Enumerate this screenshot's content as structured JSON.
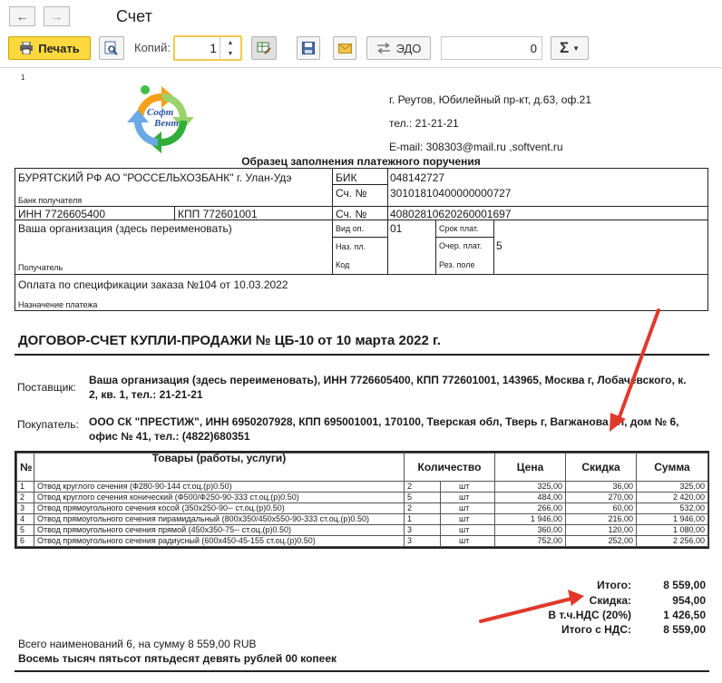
{
  "window": {
    "title": "Счет"
  },
  "toolbar": {
    "print_label": "Печать",
    "copies_label": "Копий:",
    "copies_value": "1",
    "edo_label": "ЭДО",
    "sum_value": "0",
    "sigma_label": "Σ"
  },
  "doc": {
    "page_number": "1",
    "logo_text_1": "Софт",
    "logo_text_2": "Вент",
    "address": "г. Реутов, Юбилейный пр-кт, д.63, оф.21",
    "phone": "тел.: 21-21-21",
    "email": "E-mail: 308303@mail.ru ,softvent.ru",
    "sample_title": "Образец заполнения платежного поручения",
    "payment": {
      "bank_name": "БУРЯТСКИЙ РФ АО \"РОССЕЛЬХОЗБАНК\" г. Улан-Удэ",
      "bank_caption": "Банк получателя",
      "bik_label": "БИК",
      "bik_value": "048142727",
      "corr_label": "Сч. №",
      "corr_value": "30101810400000000727",
      "inn": "ИНН   7726605400",
      "kpp": "КПП    772601001",
      "acc_label": "Сч. №",
      "acc_value": "40802810620260001697",
      "org_name": "Ваша организация (здесь переименовать)",
      "recipient_caption": "Получатель",
      "vid_op_label": "Вид оп.",
      "vid_op_value": "01",
      "srok_label": "Срок плат.",
      "naz_label": "Наз. пл.",
      "ocher_label": "Очер. плат.",
      "ocher_value": "5",
      "kod_label": "Код",
      "rez_label": "Рез. поле",
      "purpose": "Оплата по спецификации заказа №104 от 10.03.2022",
      "purpose_caption": "Назначение платежа"
    },
    "contract_title": "ДОГОВОР-СЧЕТ КУПЛИ-ПРОДАЖИ № ЦБ-10 от 10 марта 2022 г.",
    "supplier_label": "Поставщик:",
    "supplier_text": "Ваша организация (здесь переименовать), ИНН 7726605400, КПП 772601001, 143965, Москва г, Лобачевского, к. 2, кв. 1, тел.: 21-21-21",
    "buyer_label": "Покупатель:",
    "buyer_text": "ООО СК \"ПРЕСТИЖ\", ИНН 6950207928, КПП 695001001, 170100, Тверская обл, Тверь г, Вагжанова ул, дом № 6, офис № 41, тел.: (4822)680351",
    "table": {
      "headers": [
        "№",
        "Товары (работы, услуги)",
        "Количество",
        "Цена",
        "Скидка",
        "Сумма"
      ],
      "rows": [
        {
          "n": "1",
          "name": "Отвод круглого сечения (Ф280-90-144  ст.оц.(р)0.50)",
          "qty": "2",
          "unit": "шт",
          "price": "325,00",
          "discount": "36,00",
          "sum": "325,00"
        },
        {
          "n": "2",
          "name": "Отвод круглого сечения конический (Ф500/Ф250-90-333  ст.оц.(р)0.50)",
          "qty": "5",
          "unit": "шт",
          "price": "484,00",
          "discount": "270,00",
          "sum": "2 420,00"
        },
        {
          "n": "3",
          "name": "Отвод прямоугольного сечения косой (350х250-90--  ст.оц.(р)0.50)",
          "qty": "2",
          "unit": "шт",
          "price": "266,00",
          "discount": "60,00",
          "sum": "532,00"
        },
        {
          "n": "4",
          "name": "Отвод прямоугольного сечения пирамидальный (800х350/450х550-90-333 ст.оц.(р)0.50)",
          "qty": "1",
          "unit": "шт",
          "price": "1 946,00",
          "discount": "216,00",
          "sum": "1 946,00"
        },
        {
          "n": "5",
          "name": "Отвод прямоугольного сечения прямой (450х350-75--  ст.оц.(р)0.50)",
          "qty": "3",
          "unit": "шт",
          "price": "360,00",
          "discount": "120,00",
          "sum": "1 080,00"
        },
        {
          "n": "6",
          "name": "Отвод прямоугольного сечения радиусный (600х450-45-155  ст.оц.(р)0.50)",
          "qty": "3",
          "unit": "шт",
          "price": "752,00",
          "discount": "252,00",
          "sum": "2 256,00"
        }
      ]
    },
    "totals": [
      {
        "label": "Итого:",
        "value": "8 559,00"
      },
      {
        "label": "Скидка:",
        "value": "954,00"
      },
      {
        "label": "В т.ч.НДС (20%)",
        "value": "1 426,50"
      },
      {
        "label": "Итого с НДС:",
        "value": "8 559,00"
      }
    ],
    "items_count_text": "Всего наименований 6, на сумму 8 559,00 RUB",
    "amount_words": "Восемь тысяч пятьсот пятьдесят девять рублей 00 копеек"
  },
  "colors": {
    "print_button": "#ffd83f",
    "arrow": "#e0392b",
    "input_focus": "#f2c84b"
  }
}
